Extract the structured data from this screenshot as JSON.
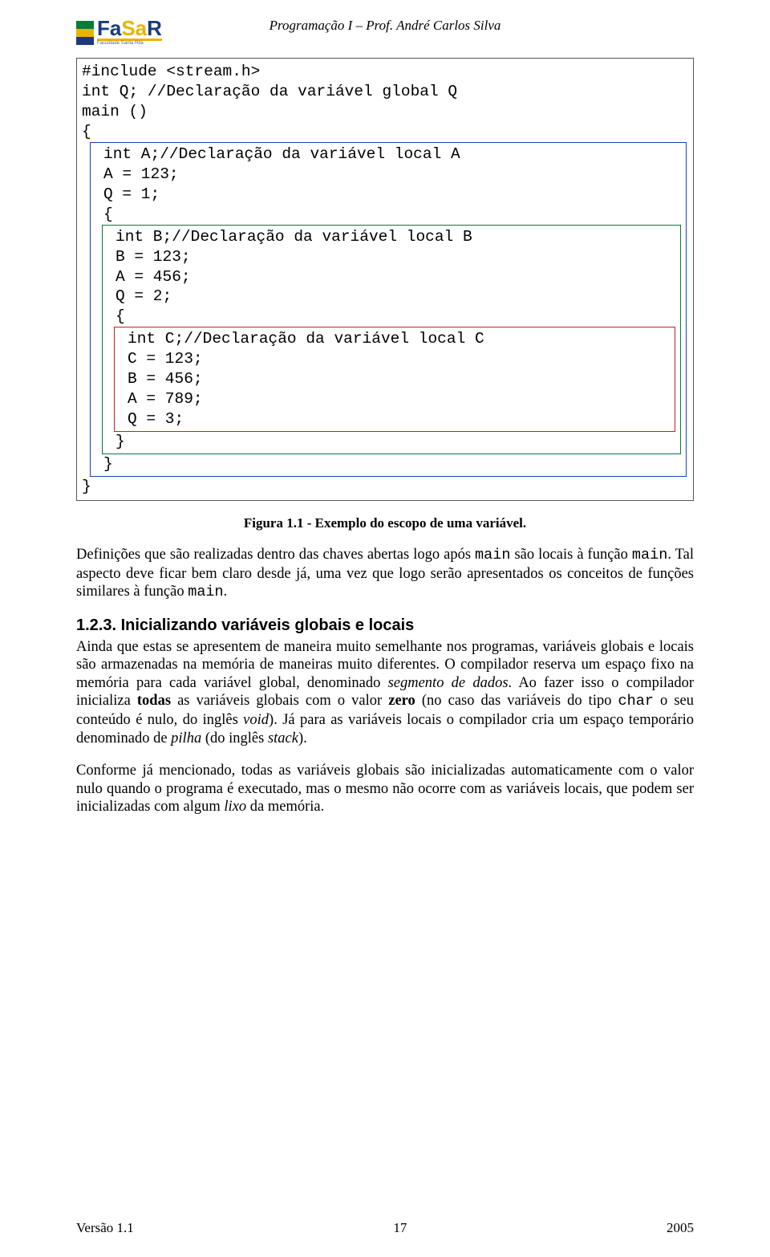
{
  "header": {
    "logo_main": "FaSaR",
    "logo_sub": "Faculdade Santa Rita",
    "title": "Programação I – Prof. André Carlos Silva"
  },
  "code": {
    "include": "#include <stream.h>",
    "decl_q": "int Q; //Declaração da variável global Q",
    "main_sig": "main ()",
    "brace_o": "{",
    "brace_c": "}",
    "decl_a": "int A;//Declaração da variável local A",
    "a123": "A = 123;",
    "q1": "Q = 1;",
    "decl_b": "int B;//Declaração da variável local B",
    "b123": "B = 123;",
    "a456": "A = 456;",
    "q2": "Q = 2;",
    "decl_c": "int C;//Declaração da variável local C",
    "c123": "C = 123;",
    "b456": "B = 456;",
    "a789": "A = 789;",
    "q3": "Q = 3;"
  },
  "caption": "Figura 1.1 - Exemplo do escopo  de uma variável.",
  "p1_a": "Definições que são realizadas dentro das chaves abertas logo após ",
  "p1_main1": "main",
  "p1_b": " são locais à função ",
  "p1_main2": "main",
  "p1_c": ". Tal aspecto deve ficar bem claro desde já, uma vez que logo serão apresentados os conceitos de funções similares à função ",
  "p1_main3": "main",
  "p1_d": ".",
  "h3": "1.2.3. Inicializando variáveis globais e locais",
  "p2_a": "Ainda que estas se apresentem de maneira muito semelhante nos programas, variáveis globais e locais são armazenadas na memória de maneiras muito diferentes. O compilador reserva um espaço fixo na memória para cada variável global, denominado ",
  "p2_seg": "segmento de dados",
  "p2_b": ". Ao fazer isso o compilador inicializa ",
  "p2_todas": "todas",
  "p2_c": " as variáveis globais com o valor ",
  "p2_zero": "zero",
  "p2_d": " (no caso das variáveis do tipo ",
  "p2_char": "char",
  "p2_e": " o seu conteúdo é nulo, do inglês ",
  "p2_void": "void",
  "p2_f": "). Já para as variáveis locais o compilador cria um espaço temporário denominado de ",
  "p2_pilha": "pilha",
  "p2_g": " (do inglês ",
  "p2_stack": "stack",
  "p2_h": ").",
  "p3_a": "Conforme já mencionado, todas as variáveis globais são inicializadas automaticamente com o valor nulo quando o programa é executado, mas o mesmo não ocorre com as variáveis locais, que podem ser inicializadas com algum ",
  "p3_lixo": "lixo",
  "p3_b": " da memória.",
  "footer": {
    "left": "Versão 1.1",
    "center": "17",
    "right": "2005"
  }
}
